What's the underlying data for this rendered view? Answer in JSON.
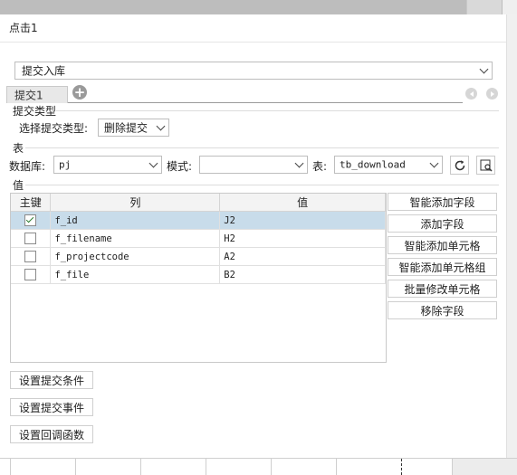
{
  "window": {
    "title": "点击1"
  },
  "submit_select": {
    "value": "提交入库"
  },
  "tabs": [
    {
      "label": "提交1"
    }
  ],
  "submit_type": {
    "section_label": "提交类型",
    "field_label": "选择提交类型:",
    "value": "删除提交"
  },
  "table_section": {
    "section_label": "表",
    "db_label": "数据库:",
    "db_value": "pj",
    "mode_label": "模式:",
    "mode_value": "",
    "table_label": "表:",
    "table_value": "tb_download"
  },
  "values_section": {
    "section_label": "值",
    "columns": [
      "主键",
      "列",
      "值"
    ],
    "rows": [
      {
        "key": true,
        "column": "f_id",
        "value": "J2",
        "selected": true
      },
      {
        "key": false,
        "column": "f_filename",
        "value": "H2",
        "selected": false
      },
      {
        "key": false,
        "column": "f_projectcode",
        "value": "A2",
        "selected": false
      },
      {
        "key": false,
        "column": "f_file",
        "value": "B2",
        "selected": false
      }
    ],
    "actions": [
      "智能添加字段",
      "添加字段",
      "智能添加单元格",
      "智能添加单元格组",
      "批量修改单元格",
      "移除字段"
    ]
  },
  "bottom_buttons": {
    "condition": "设置提交条件",
    "event": "设置提交事件",
    "callback": "设置回调函数"
  },
  "icons": {
    "add_tab": "plus-circle-icon",
    "refresh": "refresh-icon",
    "preview": "search-table-icon"
  },
  "colors": {
    "selected_row": "#c8dcea",
    "check": "#2f7d32"
  }
}
